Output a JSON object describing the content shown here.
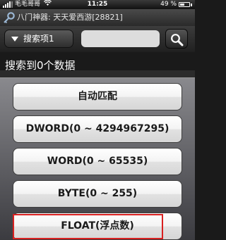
{
  "status_bar": {
    "carrier": "毛毛哥哥",
    "time": "11:25",
    "battery": "49 %",
    "battery_level": 0.49
  },
  "title_bar": {
    "title": "八门神器: 天天爱西游[28821]"
  },
  "toolbar": {
    "search_item_label": "搜索项1",
    "search_input_value": "",
    "search_input_placeholder": ""
  },
  "result": {
    "text": "搜索到0个数据"
  },
  "sheet": {
    "options": [
      {
        "label": "自动匹配"
      },
      {
        "label": "DWORD(0 ~ 4294967295)"
      },
      {
        "label": "WORD(0 ~ 65535)"
      },
      {
        "label": "BYTE(0 ~ 255)"
      },
      {
        "label": "FLOAT(浮点数)"
      }
    ]
  },
  "colors": {
    "highlight": "#d82020",
    "background": "#1a1a1a"
  }
}
